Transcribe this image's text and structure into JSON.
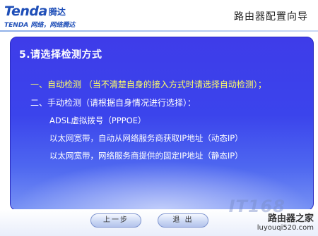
{
  "header": {
    "logo": "Tenda",
    "logo_cn": "腾达",
    "slogan": "TENDA 网络，网络腾达",
    "title": "路由器配置向导"
  },
  "step": {
    "title": "5.请选择检测方式",
    "option_auto": "一、自动检测 （当不清楚自身的接入方式时请选择自动检测）；",
    "option_manual": "二、手动检测（请根据自身情况进行选择）：",
    "manual_choices": [
      "ADSL虚拟拨号（PPPOE）",
      "以太网宽带，自动从网络服务商获取IP地址（动态IP）",
      "以太网宽带，网络服务商提供的固定IP地址（静态IP）"
    ]
  },
  "footer": {
    "prev_label": "上一步",
    "exit_label": "退 出"
  },
  "watermark": {
    "ghost": "IT168",
    "site_name": "路由器之家",
    "site_url": "luyouqi520.com"
  },
  "colors": {
    "panel": "#3e3ce9",
    "highlight": "#ffff66",
    "brand": "#1f4fb8"
  }
}
